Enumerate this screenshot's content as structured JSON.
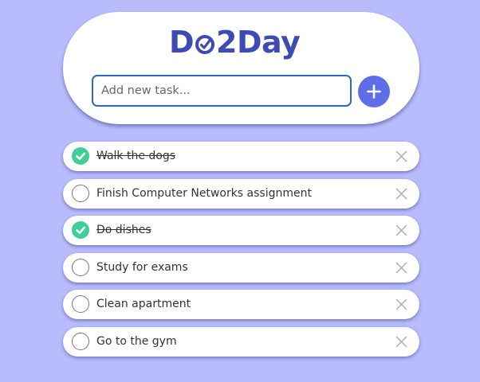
{
  "app": {
    "title_part1": "D",
    "title_o": "o",
    "title_part2": "2Day",
    "logo_color": "#3f4bb5",
    "background_color": "#b8bcfd",
    "accent_color": "#5d6ee8",
    "done_color": "#3fce98"
  },
  "new_task": {
    "value": "",
    "placeholder": "Add new task...",
    "add_icon": "plus-icon"
  },
  "tasks": [
    {
      "label": "Walk the dogs",
      "completed": true
    },
    {
      "label": "Finish Computer Networks assignment",
      "completed": false
    },
    {
      "label": "Do dishes",
      "completed": true
    },
    {
      "label": "Study for exams",
      "completed": false
    },
    {
      "label": "Clean apartment",
      "completed": false
    },
    {
      "label": "Go to the gym",
      "completed": false
    }
  ],
  "icons": {
    "check": "check-icon",
    "delete": "close-icon"
  }
}
